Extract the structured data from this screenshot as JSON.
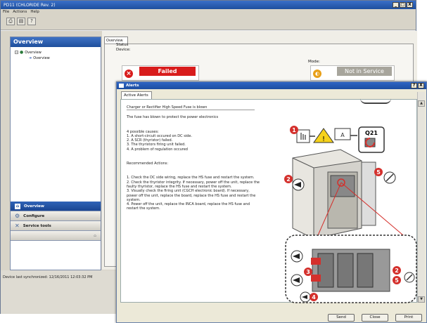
{
  "main_window": {
    "title": "PD11 (CHLORIDE Rev. 2)",
    "menu": [
      "File",
      "Actions",
      "Help"
    ],
    "toolbar": [
      "print-icon",
      "print-preview-icon",
      "help-icon"
    ],
    "controls": [
      "_",
      "□",
      "X"
    ]
  },
  "left_panel": {
    "header": "Overview",
    "tree": {
      "root": "Overview",
      "child": "Overview"
    },
    "nav": [
      {
        "label": "Overview",
        "icon": "overview-icon",
        "active": true
      },
      {
        "label": "Configure",
        "icon": "configure-icon",
        "active": false
      },
      {
        "label": "Service tools",
        "icon": "service-tools-icon",
        "active": false
      }
    ]
  },
  "content": {
    "tab": "Overview",
    "status_label": "Status",
    "device_label": "Device:",
    "device_status": "Failed",
    "mode_label": "Mode:",
    "mode_status": "Not in Service",
    "partial_left_1": "F",
    "partial_left_2": "S"
  },
  "status_bar": {
    "sync_text": "Device last synchronized: 12/16/2011 12:03:32 PM"
  },
  "alerts": {
    "title": "Alerts",
    "controls": [
      "?",
      "X"
    ],
    "tab": "Active Alerts",
    "heading": "Charger or Rectifier High Speed Fuse is blown",
    "summary": "The fuse has blown to protect the power electronics",
    "causes_title": "4 possible causes:",
    "causes": [
      "1. A short-circuit occured on DC side.",
      "2. A SCR (thyristor) failed.",
      "3. The thyristors firing unit failed.",
      "4. A problem of regulation occured"
    ],
    "actions_title": "Recommended Actions:",
    "actions": [
      "1. Check the DC side wiring, replace the HS fuse and restart the system.",
      "2. Check the thyristor integrity. If necessary, power off the unit, replace the faulty thyristor, replace the HS fuse and restart the system.",
      "3. Visually check the firing unit (CGCH electronic board). If necessary, power off the unit, replace the board, replace the HS fuse and restart the system.",
      "4. Power off the unit, replace the INCA board, replace the HS fuse and restart the system."
    ],
    "diagram_label": "Q21",
    "callouts": [
      "1",
      "2",
      "3",
      "4",
      "5"
    ],
    "buttons": {
      "send": "Send",
      "close": "Close",
      "print": "Print"
    }
  },
  "colors": {
    "title_blue": "#1d4f9e",
    "failed_red": "#d81c1c",
    "callout_red": "#d4302c",
    "panel_gray": "#d8d4c8"
  }
}
